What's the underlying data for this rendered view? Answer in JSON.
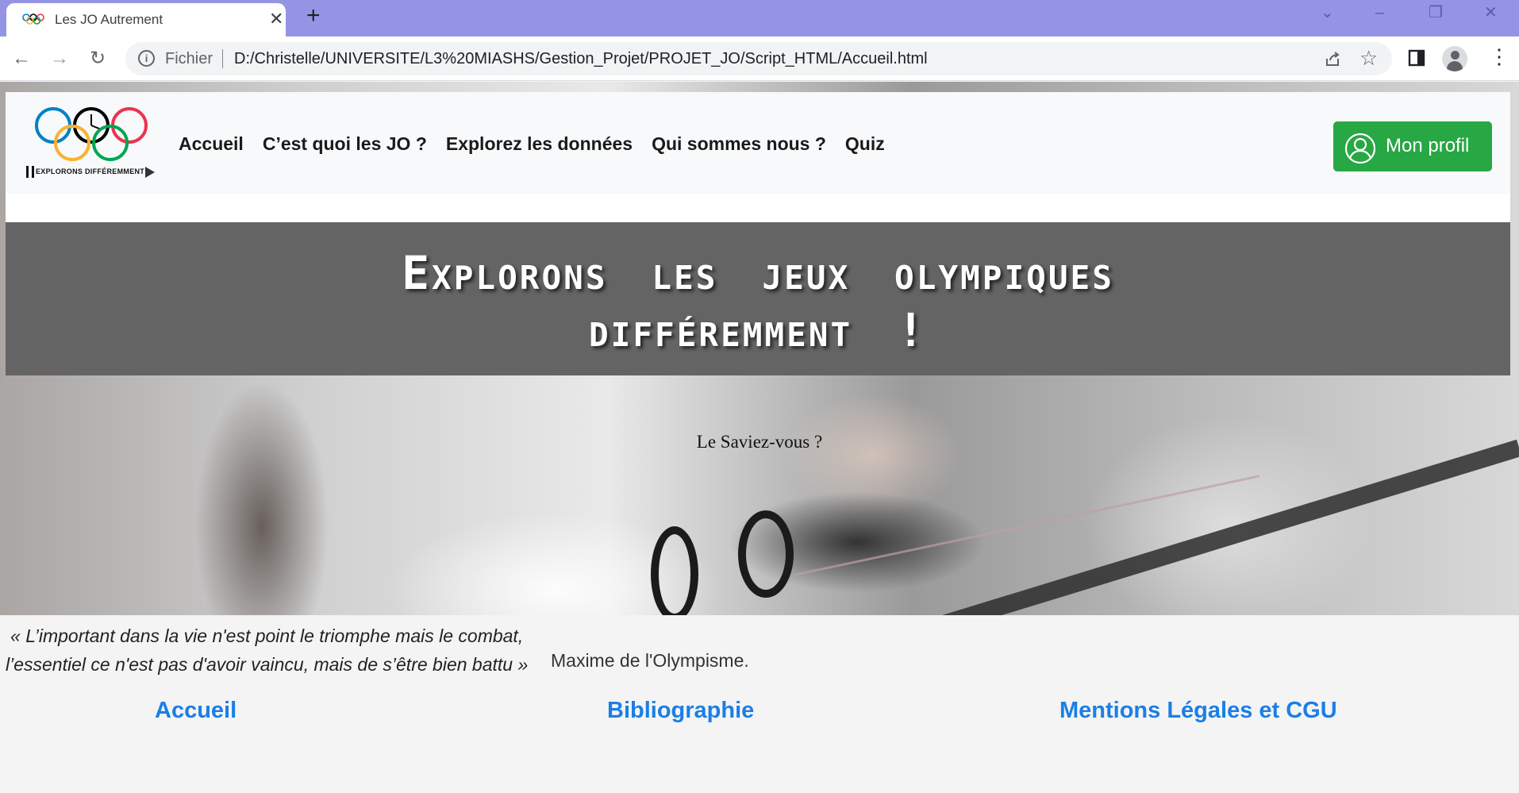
{
  "browser": {
    "tab_title": "Les JO Autrement",
    "new_tab_symbol": "+",
    "url_scheme": "Fichier",
    "url": "D:/Christelle/UNIVERSITE/L3%20MIASHS/Gestion_Projet/PROJET_JO/Script_HTML/Accueil.html"
  },
  "site": {
    "logo_text": "EXPLORONS DIFFÉREMMENT",
    "nav": [
      "Accueil",
      "C’est quoi les JO ?",
      "Explorez les données",
      "Qui sommes nous ?",
      "Quiz"
    ],
    "profile_label": "Mon profil",
    "banner_title": "Explorons les jeux olympiques différemment !",
    "did_you_know": "Le Saviez-vous ?",
    "quote_line1": "« L’important dans la vie n'est point le triomphe mais le combat,",
    "quote_line2": "l’essentiel ce n'est pas d'avoir vaincu, mais de s’être bien battu »",
    "quote_author": "Maxime de l'Olympisme.",
    "footer": [
      "Accueil",
      "Bibliographie",
      "Mentions Légales et CGU"
    ]
  },
  "colors": {
    "tabbar": "#9594e4",
    "profile_button": "#28a745",
    "banner": "#646464",
    "footer_link": "#1a7fe6",
    "olympic_rings": [
      "#0081c8",
      "#fcb131",
      "#000000",
      "#00a651",
      "#ee334e"
    ]
  },
  "icons": {
    "back": "arrow-left-icon",
    "forward": "arrow-right-icon",
    "reload": "reload-icon",
    "info": "info-icon",
    "share": "share-icon",
    "bookmark": "star-icon",
    "side_panel": "side-panel-icon",
    "profile": "user-circle-icon",
    "menu": "kebab-menu-icon"
  }
}
